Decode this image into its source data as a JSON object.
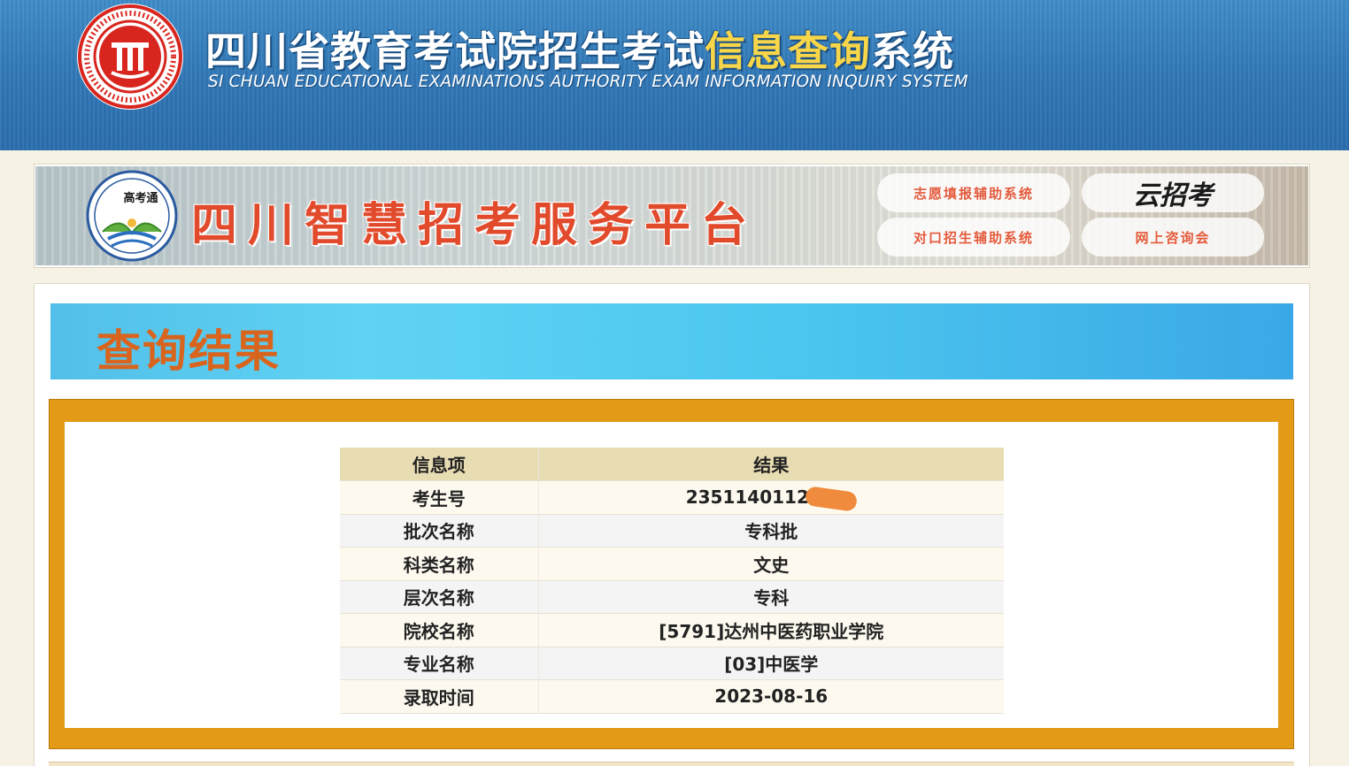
{
  "header": {
    "title_part1": "四川省教育考试院招生考试",
    "title_part2": "信息查询",
    "title_part3": "系统",
    "subtitle": "SI CHUAN EDUCATIONAL EXAMINATIONS AUTHORITY EXAM INFORMATION INQUIRY SYSTEM",
    "colors": {
      "background": "#2f76b5",
      "highlight": "#f7d64a"
    }
  },
  "banner": {
    "title": "四川智慧招考服务平台",
    "logo_text": "高考通",
    "buttons": [
      {
        "label": "志愿填报辅助系统"
      },
      {
        "label": "云招考"
      },
      {
        "label": "对口招生辅助系统"
      },
      {
        "label": "网上咨询会"
      }
    ],
    "colors": {
      "title": "#e24a2c"
    }
  },
  "result": {
    "title": "查询结果",
    "table": {
      "headers": [
        "信息项",
        "结果"
      ],
      "rows": [
        {
          "key": "考生号",
          "value": "23511401121"
        },
        {
          "key": "批次名称",
          "value": "专科批"
        },
        {
          "key": "科类名称",
          "value": "文史"
        },
        {
          "key": "层次名称",
          "value": "专科"
        },
        {
          "key": "院校名称",
          "value": "[5791]达州中医药职业学院"
        },
        {
          "key": "专业名称",
          "value": "[03]中医学"
        },
        {
          "key": "录取时间",
          "value": "2023-08-16"
        }
      ]
    },
    "colors": {
      "frame": "#e29a17",
      "title": "#d9641e",
      "header_row": "#e8dcb3"
    }
  }
}
